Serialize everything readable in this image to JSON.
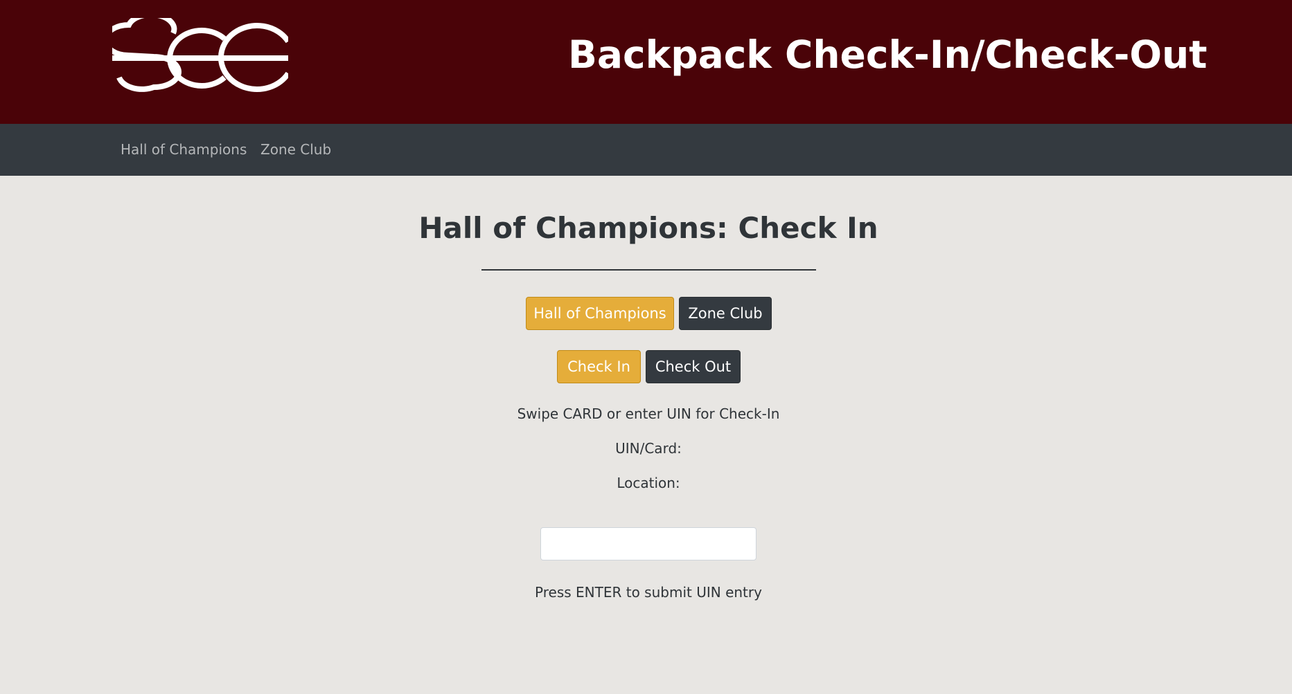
{
  "header": {
    "logo_text": "SEC",
    "title": "Backpack Check-In/Check-Out",
    "background_color": "#4a0308"
  },
  "navbar": {
    "items": [
      {
        "label": "Hall of Champions"
      },
      {
        "label": "Zone Club"
      }
    ],
    "background_color": "#343a40"
  },
  "main": {
    "page_title": "Hall of Champions: Check In",
    "location_buttons": [
      {
        "label": "Hall of Champions",
        "active": true
      },
      {
        "label": "Zone Club",
        "active": false
      }
    ],
    "mode_buttons": [
      {
        "label": "Check In",
        "active": true
      },
      {
        "label": "Check Out",
        "active": false
      }
    ],
    "instruction": "Swipe CARD or enter UIN for Check-In",
    "uin_label": "UIN/Card:",
    "location_label": "Location:",
    "uin_input": {
      "value": "",
      "placeholder": ""
    },
    "submit_hint": "Press ENTER to submit UIN entry"
  },
  "colors": {
    "accent": "#e5ad3a",
    "dark": "#343a40",
    "page_background": "#e8e6e3"
  }
}
